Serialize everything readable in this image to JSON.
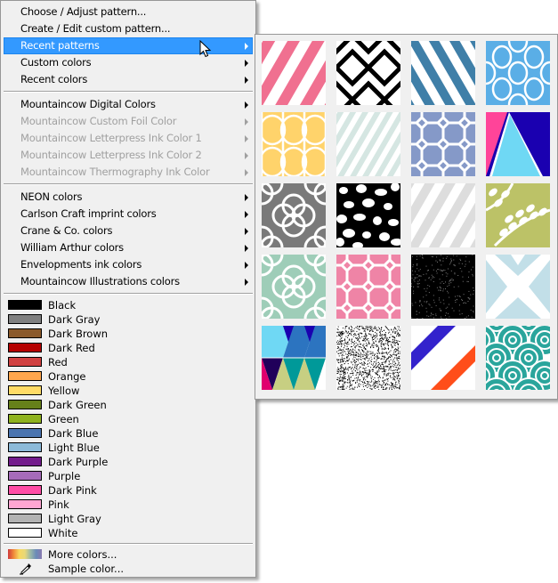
{
  "menu": {
    "top_items": [
      {
        "label": "Choose / Adjust pattern...",
        "submenu": false,
        "disabled": false,
        "highlighted": false
      },
      {
        "label": "Create / Edit custom pattern...",
        "submenu": false,
        "disabled": false,
        "highlighted": false
      },
      {
        "label": "Recent patterns",
        "submenu": true,
        "disabled": false,
        "highlighted": true
      },
      {
        "label": "Custom colors",
        "submenu": true,
        "disabled": false,
        "highlighted": false
      },
      {
        "label": "Recent colors",
        "submenu": true,
        "disabled": false,
        "highlighted": false
      }
    ],
    "mountaincow_items": [
      {
        "label": "Mountaincow Digital Colors",
        "submenu": true,
        "disabled": false
      },
      {
        "label": "Mountaincow Custom Foil Color",
        "submenu": true,
        "disabled": true
      },
      {
        "label": "Mountaincow Letterpress Ink Color 1",
        "submenu": true,
        "disabled": true
      },
      {
        "label": "Mountaincow Letterpress Ink Color 2",
        "submenu": true,
        "disabled": true
      },
      {
        "label": "Mountaincow Thermography Ink Color",
        "submenu": true,
        "disabled": true
      }
    ],
    "vendor_items": [
      {
        "label": "NEON colors",
        "submenu": true
      },
      {
        "label": "Carlson Craft imprint colors",
        "submenu": true
      },
      {
        "label": "Crane & Co. colors",
        "submenu": true
      },
      {
        "label": "William Arthur colors",
        "submenu": true
      },
      {
        "label": "Envelopments ink colors",
        "submenu": true
      },
      {
        "label": "Mountaincow Illustrations colors",
        "submenu": true
      }
    ],
    "colors": [
      {
        "label": "Black",
        "color": "#000000"
      },
      {
        "label": "Dark Gray",
        "color": "#808080"
      },
      {
        "label": "Dark Brown",
        "color": "#8b5a2b"
      },
      {
        "label": "Dark Red",
        "color": "#b50000"
      },
      {
        "label": "Red",
        "color": "#d04040"
      },
      {
        "label": "Orange",
        "color": "#ffa64d"
      },
      {
        "label": "Yellow",
        "color": "#ffdb66"
      },
      {
        "label": "Dark Green",
        "color": "#66801a"
      },
      {
        "label": "Green",
        "color": "#8fb31f"
      },
      {
        "label": "Dark Blue",
        "color": "#4a74b0"
      },
      {
        "label": "Light Blue",
        "color": "#8cbad9"
      },
      {
        "label": "Dark Purple",
        "color": "#731c8c"
      },
      {
        "label": "Purple",
        "color": "#a66bba"
      },
      {
        "label": "Dark Pink",
        "color": "#ff4da6"
      },
      {
        "label": "Pink",
        "color": "#ffa6d2"
      },
      {
        "label": "Light Gray",
        "color": "#b3b3b3"
      },
      {
        "label": "White",
        "color": "#ffffff"
      }
    ],
    "more_colors_label": "More colors...",
    "sample_color_label": "Sample color..."
  },
  "recent_patterns": {
    "title": "Recent patterns",
    "tiles": [
      {
        "name": "pink-diagonal-stripes",
        "colors": [
          "#f07090",
          "#ffffff"
        ]
      },
      {
        "name": "black-ikat-diamonds",
        "colors": [
          "#000000",
          "#ffffff"
        ]
      },
      {
        "name": "blue-diagonal-stripes",
        "colors": [
          "#3f7fa8",
          "#ffffff"
        ]
      },
      {
        "name": "light-blue-ovals-lattice",
        "colors": [
          "#5aaee6",
          "#ffffff"
        ]
      },
      {
        "name": "yellow-arches-trellis",
        "colors": [
          "#ffd36b",
          "#ffffff"
        ]
      },
      {
        "name": "mint-thin-stripes",
        "colors": [
          "#d5e6e2",
          "#ffffff"
        ]
      },
      {
        "name": "periwinkle-chain-link",
        "colors": [
          "#8599c8",
          "#ffffff"
        ]
      },
      {
        "name": "pink-navy-triangles",
        "colors": [
          "#ff4499",
          "#1a00b0",
          "#6fd8f4"
        ]
      },
      {
        "name": "gray-quatrefoil",
        "colors": [
          "#7a7a7a",
          "#ffffff"
        ]
      },
      {
        "name": "black-white-spots",
        "colors": [
          "#000000",
          "#ffffff"
        ]
      },
      {
        "name": "light-gray-stripes",
        "colors": [
          "#dddddd",
          "#ffffff"
        ]
      },
      {
        "name": "olive-leaf-vines",
        "colors": [
          "#bcc267",
          "#ffffff"
        ]
      },
      {
        "name": "mint-quatrefoil",
        "colors": [
          "#9ecdb8",
          "#ffffff"
        ]
      },
      {
        "name": "pink-chain-link",
        "colors": [
          "#ef84a6",
          "#ffffff"
        ]
      },
      {
        "name": "black-glitter",
        "colors": [
          "#000000",
          "#777777"
        ]
      },
      {
        "name": "light-blue-x",
        "colors": [
          "#c2dfe8",
          "#ffffff"
        ]
      },
      {
        "name": "multicolor-harlequin",
        "colors": [
          "#1a00b0",
          "#6fd8f4",
          "#2c74c0",
          "#20005a",
          "#c7cf82",
          "#009999",
          "#e0006e"
        ]
      },
      {
        "name": "black-damask-paisley",
        "colors": [
          "#000000",
          "#ffffff"
        ]
      },
      {
        "name": "blue-red-glitter-stripes",
        "colors": [
          "#3322cc",
          "#ff4e1a",
          "#ffffff"
        ]
      },
      {
        "name": "teal-circles-scales",
        "colors": [
          "#2aa59c",
          "#ffffff"
        ]
      }
    ]
  }
}
